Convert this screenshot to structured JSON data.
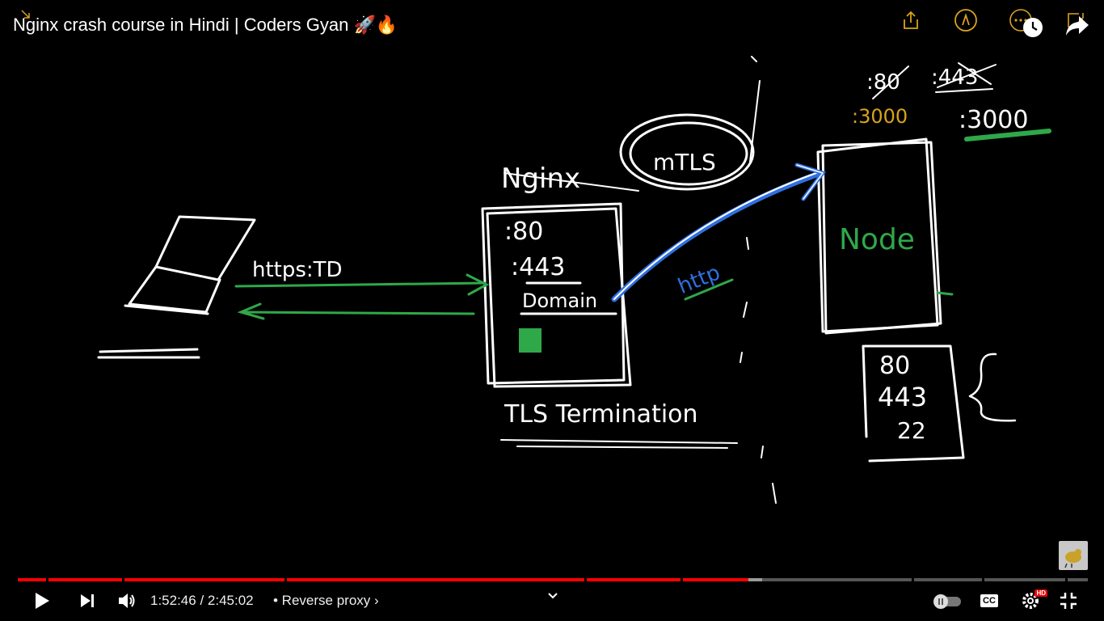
{
  "video": {
    "title": "Nginx crash course in Hindi | Coders Gyan 🚀🔥"
  },
  "whiteboard": {
    "client_label": "https:TD",
    "nginx_label": "Nginx",
    "nginx_ports": [
      ":80",
      ":443"
    ],
    "nginx_domain": "Domain",
    "mtls_label": "mTLS",
    "http_label": "http",
    "tls_termination": "TLS Termination",
    "node_label": "Node",
    "node_port_80": ":80",
    "node_port_443": ":443",
    "node_port_3000_orange": ":3000",
    "node_port_3000_white": ":3000",
    "port_list": [
      "80",
      "443",
      "22"
    ]
  },
  "colors": {
    "ink_white": "#ffffff",
    "ink_green": "#2fa84a",
    "ink_blue": "#2f6fe0",
    "ink_orange": "#d9a21b",
    "progress_played": "#ff0000"
  },
  "player": {
    "current_time": "1:52:46",
    "separator": " / ",
    "duration": "2:45:02",
    "chapter": "• Reverse proxy",
    "chapter_chevron": "›",
    "progress_played_fraction": 0.6831,
    "buffered_fraction": 0.6953,
    "icons": {
      "share": "share-icon",
      "watch_later": "clock-icon",
      "forward": "forward-share-icon",
      "more": "more-icon",
      "play": "play-icon",
      "next": "next-icon",
      "volume": "volume-icon",
      "chevron": "chevron-down-icon",
      "autoplay": "autoplay-toggle",
      "cc": "cc-icon",
      "settings": "settings-icon",
      "exit_fullscreen": "exit-fullscreen-icon"
    },
    "cc_label": "CC",
    "hd_label": "HD"
  }
}
